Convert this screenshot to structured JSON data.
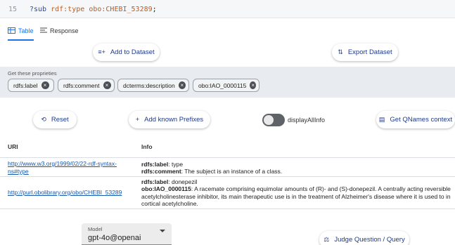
{
  "editor": {
    "line_number": "15",
    "var": "?sub",
    "predicate": "rdf:type",
    "object": "obo:CHEBI_53289",
    "end": ";"
  },
  "tabs": [
    {
      "label": "Table",
      "icon": "table-icon",
      "active": true
    },
    {
      "label": "Response",
      "icon": "text-lines-icon",
      "active": false
    }
  ],
  "actions": {
    "add_to_dataset": "Add to Dataset",
    "export_dataset": "Export Dataset",
    "reset": "Reset",
    "add_prefixes": "Add known Prefixes",
    "get_qnames": "Get QNames context",
    "judge": "Judge Question / Query"
  },
  "properties": {
    "label": "Get these proprieties",
    "chips": [
      "rdfs:label",
      "rdfs:comment",
      "dcterms:description",
      "obo:IAO_0000115"
    ]
  },
  "display_all_info": {
    "label": "displayAllInfo",
    "on": false
  },
  "table": {
    "headers": {
      "uri": "URI",
      "info": "Info"
    },
    "rows": [
      {
        "uri_line1": "http://www.w3.org/1999/02/22-rdf-syntax-",
        "uri_line2": "ns#type",
        "info": [
          {
            "key": "rdfs:label",
            "value": ": type"
          },
          {
            "key": "rdfs:comment",
            "value": ": The subject is an instance of a class."
          }
        ]
      },
      {
        "uri": "http://purl.obolibrary.org/obo/CHEBI_53289",
        "info_label_key": "rdfs:label",
        "info_label_value": ": donepezil",
        "info_def_key": "obo:IAO_0000115",
        "info_def_line1": ": A racemate comprising equimolar amounts of (R)- and (S)-donepezil. A centrally acting reversible",
        "info_def_line2": "acetylcholinesterase inhibitor, its main therapeutic use is in the treatment of Alzheimer's disease where it is used to in",
        "info_def_line3": "cortical acetylcholine."
      }
    ]
  },
  "model": {
    "label": "Model",
    "value": "gpt-4o@openai"
  },
  "colors": {
    "accent": "#1a73e8",
    "button_text": "#1e3a8a",
    "panel": "#e8ebef"
  }
}
